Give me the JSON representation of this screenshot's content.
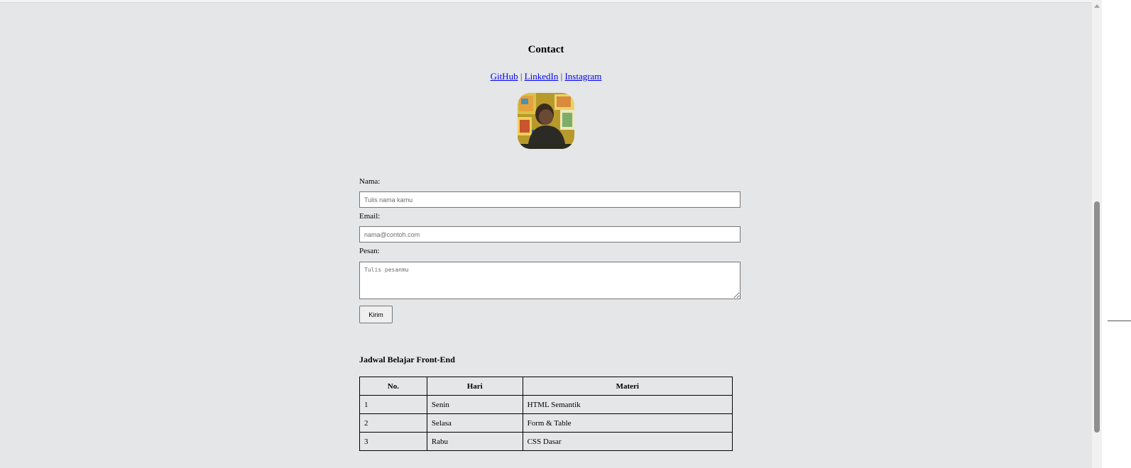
{
  "contact": {
    "title": "Contact",
    "links": [
      {
        "label": "GitHub"
      },
      {
        "label": "LinkedIn"
      },
      {
        "label": "Instagram"
      }
    ],
    "separator": "|"
  },
  "form": {
    "name_label": "Nama:",
    "name_placeholder": "Tulis nama kamu",
    "email_label": "Email:",
    "email_placeholder": "nama@contoh.com",
    "message_label": "Pesan:",
    "message_placeholder": "Tulis pesanmu",
    "submit_label": "Kirim"
  },
  "schedule": {
    "title": "Jadwal Belajar Front-End",
    "headers": [
      "No.",
      "Hari",
      "Materi"
    ],
    "rows": [
      [
        "1",
        "Senin",
        "HTML Semantik"
      ],
      [
        "2",
        "Selasa",
        "Form & Table"
      ],
      [
        "3",
        "Rabu",
        "CSS Dasar"
      ]
    ]
  },
  "colors": {
    "background": "#e5e6e8",
    "link": "#0000ee"
  }
}
